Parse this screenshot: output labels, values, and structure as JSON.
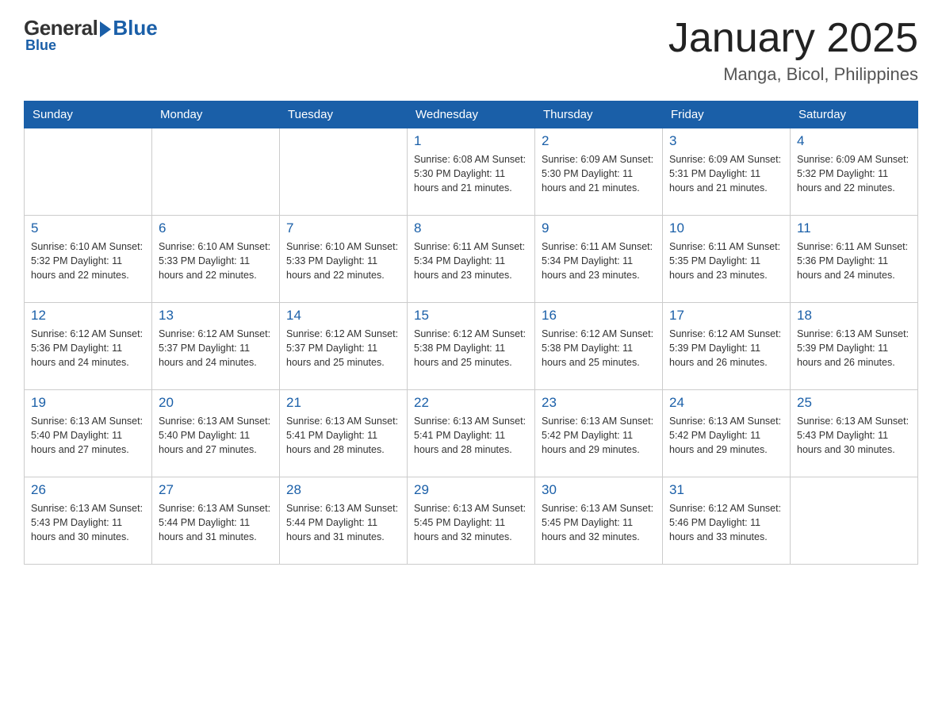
{
  "header": {
    "logo_general": "General",
    "logo_blue": "Blue",
    "title": "January 2025",
    "subtitle": "Manga, Bicol, Philippines"
  },
  "days_of_week": [
    "Sunday",
    "Monday",
    "Tuesday",
    "Wednesday",
    "Thursday",
    "Friday",
    "Saturday"
  ],
  "weeks": [
    [
      {
        "day": "",
        "info": ""
      },
      {
        "day": "",
        "info": ""
      },
      {
        "day": "",
        "info": ""
      },
      {
        "day": "1",
        "info": "Sunrise: 6:08 AM\nSunset: 5:30 PM\nDaylight: 11 hours\nand 21 minutes."
      },
      {
        "day": "2",
        "info": "Sunrise: 6:09 AM\nSunset: 5:30 PM\nDaylight: 11 hours\nand 21 minutes."
      },
      {
        "day": "3",
        "info": "Sunrise: 6:09 AM\nSunset: 5:31 PM\nDaylight: 11 hours\nand 21 minutes."
      },
      {
        "day": "4",
        "info": "Sunrise: 6:09 AM\nSunset: 5:32 PM\nDaylight: 11 hours\nand 22 minutes."
      }
    ],
    [
      {
        "day": "5",
        "info": "Sunrise: 6:10 AM\nSunset: 5:32 PM\nDaylight: 11 hours\nand 22 minutes."
      },
      {
        "day": "6",
        "info": "Sunrise: 6:10 AM\nSunset: 5:33 PM\nDaylight: 11 hours\nand 22 minutes."
      },
      {
        "day": "7",
        "info": "Sunrise: 6:10 AM\nSunset: 5:33 PM\nDaylight: 11 hours\nand 22 minutes."
      },
      {
        "day": "8",
        "info": "Sunrise: 6:11 AM\nSunset: 5:34 PM\nDaylight: 11 hours\nand 23 minutes."
      },
      {
        "day": "9",
        "info": "Sunrise: 6:11 AM\nSunset: 5:34 PM\nDaylight: 11 hours\nand 23 minutes."
      },
      {
        "day": "10",
        "info": "Sunrise: 6:11 AM\nSunset: 5:35 PM\nDaylight: 11 hours\nand 23 minutes."
      },
      {
        "day": "11",
        "info": "Sunrise: 6:11 AM\nSunset: 5:36 PM\nDaylight: 11 hours\nand 24 minutes."
      }
    ],
    [
      {
        "day": "12",
        "info": "Sunrise: 6:12 AM\nSunset: 5:36 PM\nDaylight: 11 hours\nand 24 minutes."
      },
      {
        "day": "13",
        "info": "Sunrise: 6:12 AM\nSunset: 5:37 PM\nDaylight: 11 hours\nand 24 minutes."
      },
      {
        "day": "14",
        "info": "Sunrise: 6:12 AM\nSunset: 5:37 PM\nDaylight: 11 hours\nand 25 minutes."
      },
      {
        "day": "15",
        "info": "Sunrise: 6:12 AM\nSunset: 5:38 PM\nDaylight: 11 hours\nand 25 minutes."
      },
      {
        "day": "16",
        "info": "Sunrise: 6:12 AM\nSunset: 5:38 PM\nDaylight: 11 hours\nand 25 minutes."
      },
      {
        "day": "17",
        "info": "Sunrise: 6:12 AM\nSunset: 5:39 PM\nDaylight: 11 hours\nand 26 minutes."
      },
      {
        "day": "18",
        "info": "Sunrise: 6:13 AM\nSunset: 5:39 PM\nDaylight: 11 hours\nand 26 minutes."
      }
    ],
    [
      {
        "day": "19",
        "info": "Sunrise: 6:13 AM\nSunset: 5:40 PM\nDaylight: 11 hours\nand 27 minutes."
      },
      {
        "day": "20",
        "info": "Sunrise: 6:13 AM\nSunset: 5:40 PM\nDaylight: 11 hours\nand 27 minutes."
      },
      {
        "day": "21",
        "info": "Sunrise: 6:13 AM\nSunset: 5:41 PM\nDaylight: 11 hours\nand 28 minutes."
      },
      {
        "day": "22",
        "info": "Sunrise: 6:13 AM\nSunset: 5:41 PM\nDaylight: 11 hours\nand 28 minutes."
      },
      {
        "day": "23",
        "info": "Sunrise: 6:13 AM\nSunset: 5:42 PM\nDaylight: 11 hours\nand 29 minutes."
      },
      {
        "day": "24",
        "info": "Sunrise: 6:13 AM\nSunset: 5:42 PM\nDaylight: 11 hours\nand 29 minutes."
      },
      {
        "day": "25",
        "info": "Sunrise: 6:13 AM\nSunset: 5:43 PM\nDaylight: 11 hours\nand 30 minutes."
      }
    ],
    [
      {
        "day": "26",
        "info": "Sunrise: 6:13 AM\nSunset: 5:43 PM\nDaylight: 11 hours\nand 30 minutes."
      },
      {
        "day": "27",
        "info": "Sunrise: 6:13 AM\nSunset: 5:44 PM\nDaylight: 11 hours\nand 31 minutes."
      },
      {
        "day": "28",
        "info": "Sunrise: 6:13 AM\nSunset: 5:44 PM\nDaylight: 11 hours\nand 31 minutes."
      },
      {
        "day": "29",
        "info": "Sunrise: 6:13 AM\nSunset: 5:45 PM\nDaylight: 11 hours\nand 32 minutes."
      },
      {
        "day": "30",
        "info": "Sunrise: 6:13 AM\nSunset: 5:45 PM\nDaylight: 11 hours\nand 32 minutes."
      },
      {
        "day": "31",
        "info": "Sunrise: 6:12 AM\nSunset: 5:46 PM\nDaylight: 11 hours\nand 33 minutes."
      },
      {
        "day": "",
        "info": ""
      }
    ]
  ]
}
